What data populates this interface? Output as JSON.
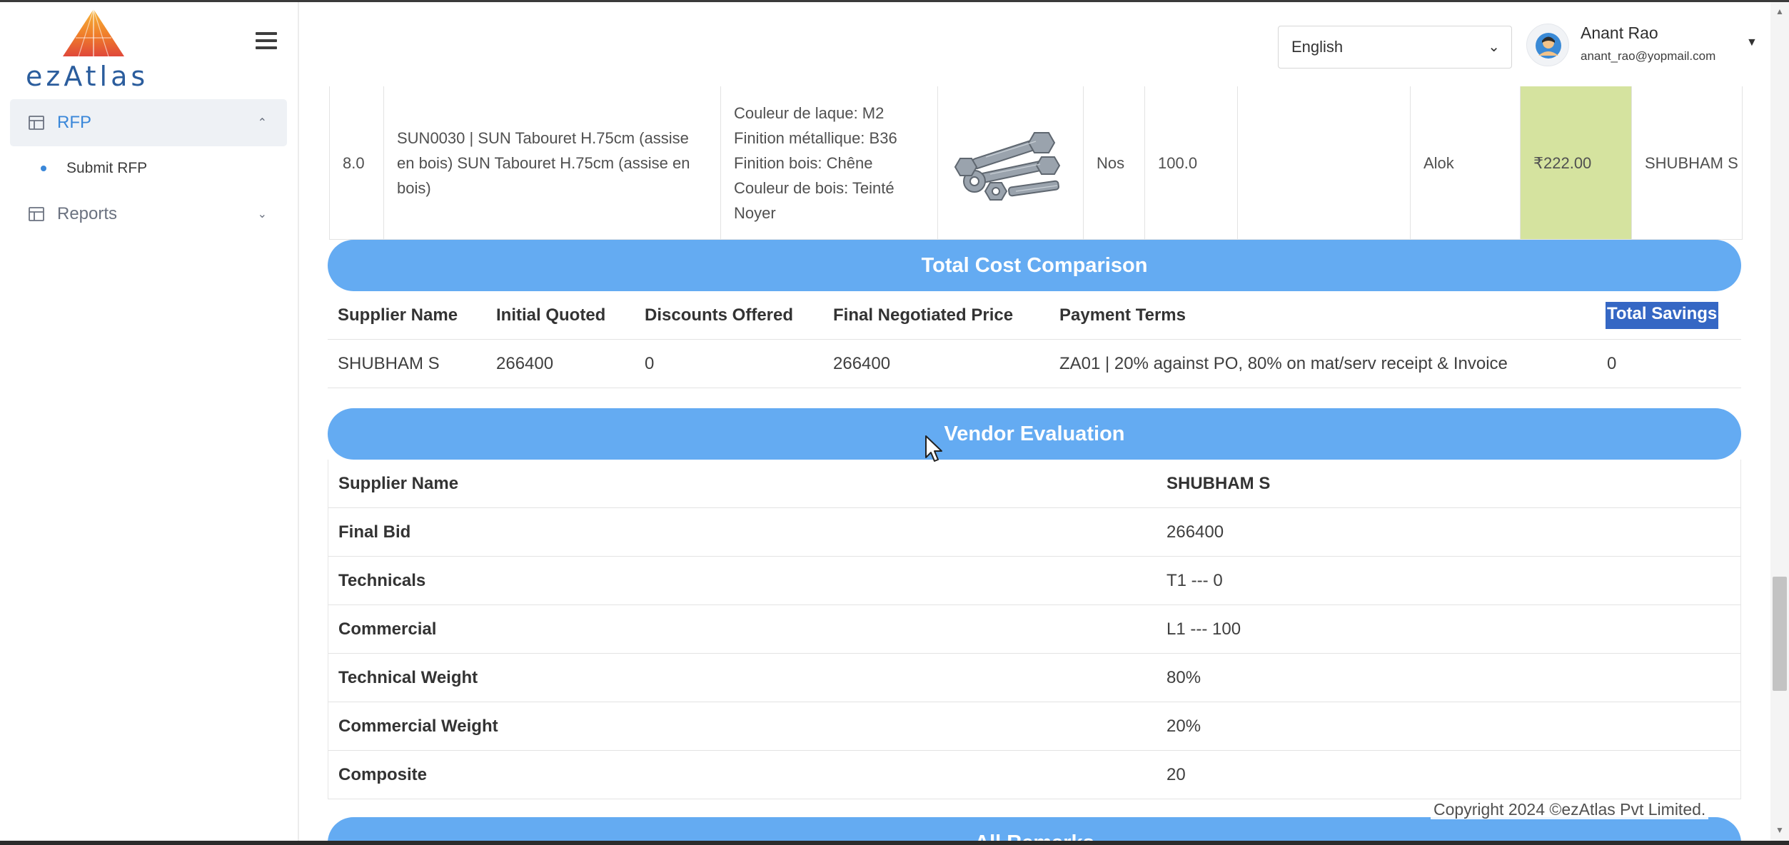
{
  "brand": {
    "name": "ezAtlas"
  },
  "header": {
    "language": "English",
    "user": {
      "name": "Anant Rao",
      "email": "anant_rao@yopmail.com"
    }
  },
  "sidebar": {
    "items": [
      {
        "label": "RFP",
        "icon": "table-icon",
        "expanded": true,
        "children": [
          {
            "label": "Submit RFP"
          }
        ]
      },
      {
        "label": "Reports",
        "icon": "table-icon",
        "expanded": false
      }
    ]
  },
  "item_row": {
    "sn": "8.0",
    "description": "SUN0030 | SUN Tabouret H.75cm (assise en bois) SUN Tabouret H.75cm (assise en bois)",
    "specs": [
      "Couleur de laque: M2",
      "Finition métallique: B36",
      "Finition bois: Chêne",
      "Couleur de bois: Teinté Noyer"
    ],
    "image": "bolts-and-nuts-image",
    "uom": "Nos",
    "quantity": "100.0",
    "blank": "",
    "buyer": "Alok",
    "price": "₹222.00",
    "supplier": "SHUBHAM S"
  },
  "cost_comparison": {
    "title": "Total Cost Comparison",
    "headers": [
      "Supplier Name",
      "Initial Quoted",
      "Discounts Offered",
      "Final Negotiated Price",
      "Payment Terms",
      "Total Savings"
    ],
    "rows": [
      [
        "SHUBHAM S",
        "266400",
        "0",
        "266400",
        "ZA01 | 20% against PO, 80% on mat/serv receipt & Invoice",
        "0"
      ]
    ]
  },
  "vendor_evaluation": {
    "title": "Vendor Evaluation",
    "rows": [
      {
        "label": "Supplier Name",
        "value": "SHUBHAM S"
      },
      {
        "label": "Final Bid",
        "value": "266400"
      },
      {
        "label": "Technicals",
        "value": "T1 --- 0"
      },
      {
        "label": "Commercial",
        "value": "L1 --- 100"
      },
      {
        "label": "Technical Weight",
        "value": "80%"
      },
      {
        "label": "Commercial Weight",
        "value": "20%"
      },
      {
        "label": "Composite",
        "value": "20"
      }
    ]
  },
  "remarks": {
    "title": "All Remarks"
  },
  "footer": {
    "copyright": "Copyright 2024 ©ezAtlas Pvt Limited."
  },
  "colors": {
    "accent": "#64abf2",
    "active_nav": "#3a87d9",
    "price_highlight": "#d5e39f",
    "selection": "#3567c4"
  }
}
